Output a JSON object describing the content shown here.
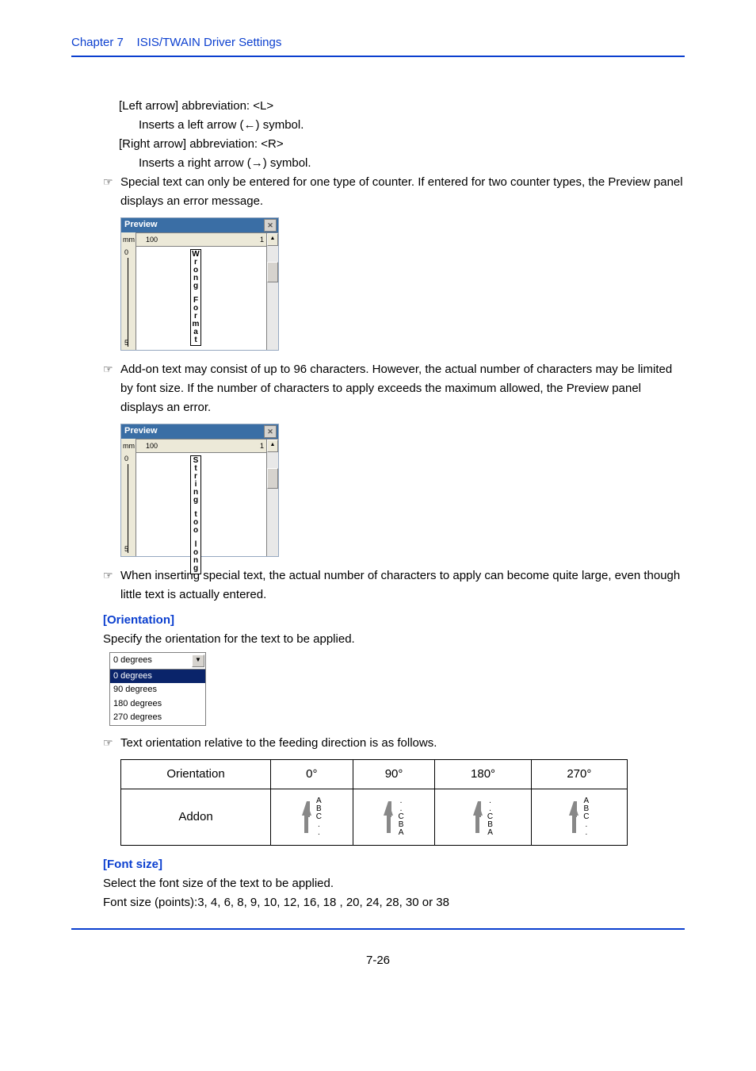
{
  "header": {
    "chapter": "Chapter 7",
    "title": "ISIS/TWAIN Driver Settings"
  },
  "body": {
    "left_arrow_label": "[Left arrow] abbreviation: <L>",
    "left_arrow_desc": "Inserts a left arrow (←) symbol.",
    "right_arrow_label": "[Right arrow] abbreviation: <R>",
    "right_arrow_desc": "Inserts a right arrow (→) symbol.",
    "note1": "Special text can only be entered for one type of counter. If entered for two counter types, the Preview panel displays an error message.",
    "preview_title": "Preview",
    "preview_mm": "mm",
    "preview_top100": "100",
    "preview_top1": "1",
    "preview_zero": "0",
    "preview_fifty": "5",
    "wrong_fmt_chars": [
      "W",
      "r",
      "o",
      "n",
      "g",
      "",
      "F",
      "o",
      "r",
      "m",
      "a",
      "t"
    ],
    "note2": "Add-on text may consist of up to 96 characters. However, the actual number of characters may be limited by font size. If the number of characters to apply exceeds the maximum allowed, the Preview panel displays an error.",
    "too_long_chars": [
      "S",
      "t",
      "r",
      "i",
      "n",
      "g",
      "",
      "t",
      "o",
      "o",
      "",
      "l",
      "o",
      "n",
      "g"
    ],
    "note3": "When inserting special text, the actual number of characters to apply can become quite large, even though little text is actually entered.",
    "orientation_head": "[Orientation]",
    "orientation_desc": "Specify the orientation for the text to be applied.",
    "dd_selected": "0 degrees",
    "dd_items": [
      "0 degrees",
      "90 degrees",
      "180 degrees",
      "270 degrees"
    ],
    "note4": "Text orientation relative to the feeding direction is as follows.",
    "table": {
      "h1": "Orientation",
      "h2": "0°",
      "h3": "90°",
      "h4": "180°",
      "h5": "270°",
      "row_label": "Addon"
    },
    "abc_norm": [
      "A",
      "B",
      "C",
      ".",
      "."
    ],
    "abc_rev": [
      ".",
      ".",
      "C",
      "B",
      "A"
    ],
    "font_size_head": "[Font size]",
    "font_size_l1": "Select the font size of the text to be applied.",
    "font_size_l2": "Font size (points):3, 4, 6, 8, 9, 10, 12, 16, 18 , 20, 24, 28, 30 or 38"
  },
  "footer": {
    "page": "7-26"
  }
}
